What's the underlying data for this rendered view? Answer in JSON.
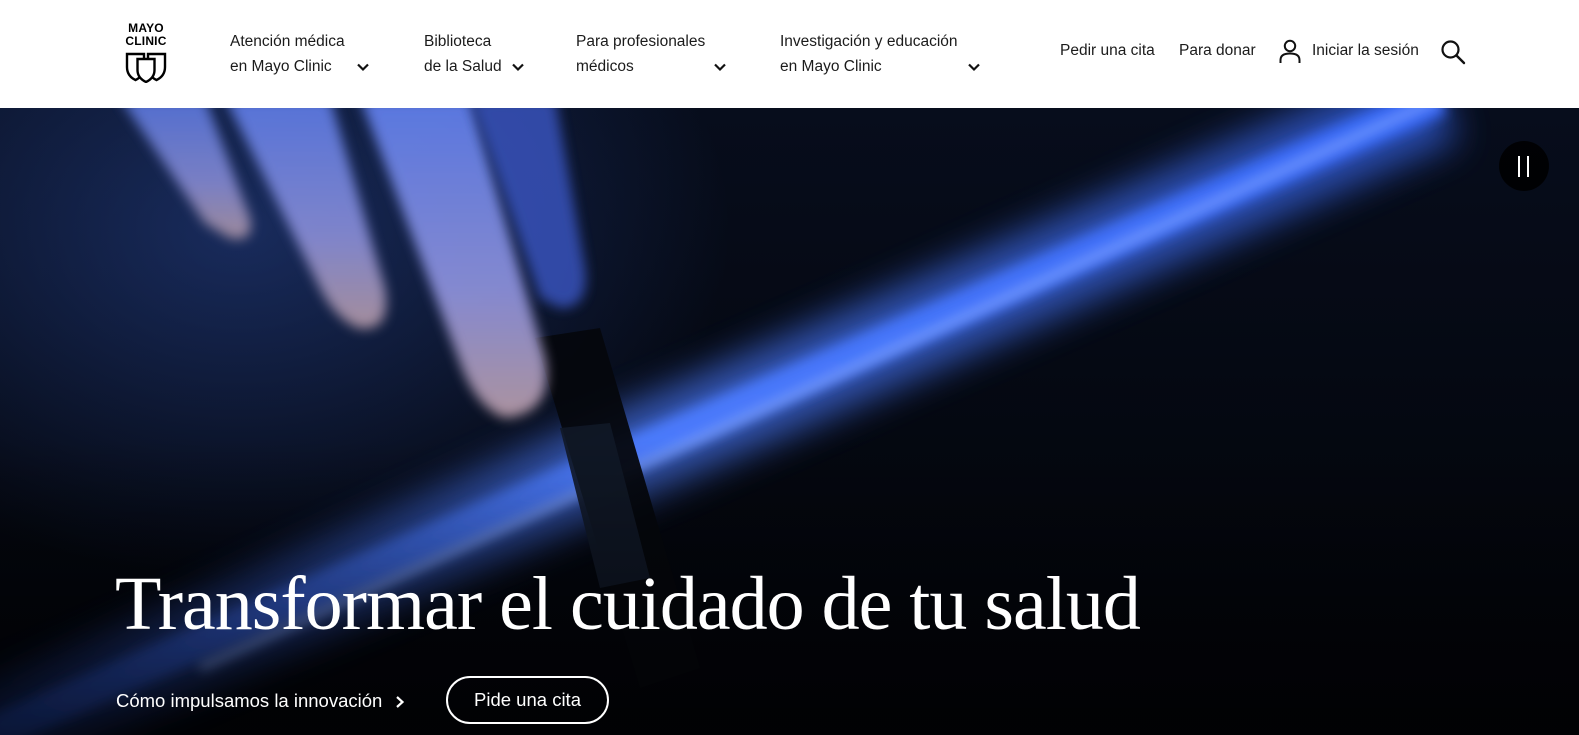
{
  "brand": {
    "logo_text": "MAYO\nCLINIC"
  },
  "nav": {
    "items": [
      {
        "line1": "Atención médica",
        "line2": "en Mayo Clinic"
      },
      {
        "line1": "Biblioteca",
        "line2": "de la Salud"
      },
      {
        "line1": "Para profesionales",
        "line2": "médicos"
      },
      {
        "line1": "Investigación y educación",
        "line2": "en Mayo Clinic"
      }
    ],
    "appointment_link": "Pedir una cita",
    "donate_link": "Para donar",
    "signin_label": "Iniciar la sesión"
  },
  "icons": {
    "logo": "mayo-shields-logo",
    "chevron": "chevron-down-icon",
    "user": "user-icon",
    "search": "search-icon",
    "pause": "pause-icon",
    "arrow": "chevron-right-icon"
  },
  "hero": {
    "title": "Transformar el cuidado de tu salud",
    "innovation_link": "Cómo impulsamos la innovación",
    "appointment_button": "Pide una cita"
  },
  "colors": {
    "header_bg": "#ffffff",
    "text": "#1b1b1b",
    "hero_bg": "#050a16",
    "hero_glow": "#3f78ff",
    "hero_text": "#ffffff"
  }
}
